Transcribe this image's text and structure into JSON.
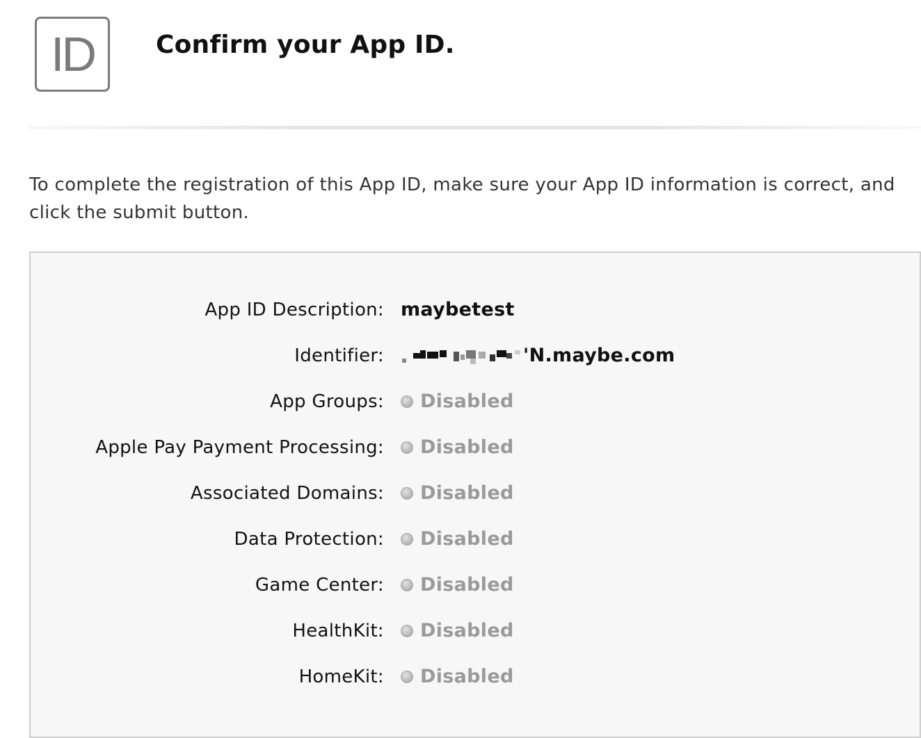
{
  "header": {
    "badge_text": "ID",
    "title": "Confirm your App ID."
  },
  "intro_text": "To complete the registration of this App ID, make sure your App ID information is correct, and click the submit button.",
  "details": {
    "description": {
      "label": "App ID Description:",
      "value": "maybetest"
    },
    "identifier": {
      "label": "Identifier:",
      "value_suffix": "'N.maybe.com"
    },
    "capabilities": [
      {
        "label": "App Groups:",
        "status": "Disabled"
      },
      {
        "label": "Apple Pay Payment Processing:",
        "status": "Disabled"
      },
      {
        "label": "Associated Domains:",
        "status": "Disabled"
      },
      {
        "label": "Data Protection:",
        "status": "Disabled"
      },
      {
        "label": "Game Center:",
        "status": "Disabled"
      },
      {
        "label": "HealthKit:",
        "status": "Disabled"
      },
      {
        "label": "HomeKit:",
        "status": "Disabled"
      }
    ]
  },
  "colors": {
    "disabled_text": "#9a9a9a",
    "badge_border": "#7a7a7a",
    "panel_background": "#f7f7f7"
  }
}
